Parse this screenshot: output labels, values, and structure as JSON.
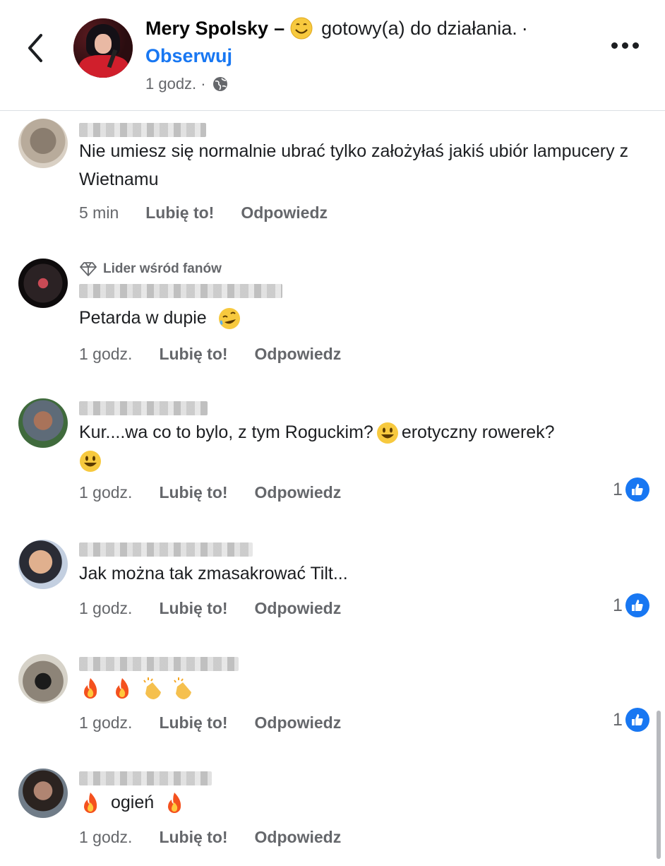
{
  "post": {
    "author": "Mery Spolsky",
    "dash": "–",
    "status": "gotowy(a) do działania.",
    "dot": "·",
    "follow_label": "Obserwuj",
    "time": "1 godz. ·",
    "more_label": "More options"
  },
  "comments": [
    {
      "text": "Nie umiesz się normalnie ubrać tylko założyłaś jakiś ubiór lampucery z Wietnamu",
      "time": "5 min",
      "like": "Lubię to!",
      "reply": "Odpowiedz"
    },
    {
      "badge": "Lider wśród fanów",
      "text": "Petarda w dupie",
      "time": "1 godz.",
      "like": "Lubię to!",
      "reply": "Odpowiedz"
    },
    {
      "text": "Kur....wa co to bylo, z tym Roguckim?",
      "text2": "erotyczny rowerek?",
      "time": "1 godz.",
      "like": "Lubię to!",
      "reply": "Odpowiedz",
      "reactions": "1"
    },
    {
      "text": "Jak można tak zmasakrować Tilt...",
      "time": "1 godz.",
      "like": "Lubię to!",
      "reply": "Odpowiedz",
      "reactions": "1"
    },
    {
      "text": "",
      "time": "1 godz.",
      "like": "Lubię to!",
      "reply": "Odpowiedz",
      "reactions": "1"
    },
    {
      "text": "ogień",
      "time": "1 godz.",
      "like": "Lubię to!",
      "reply": "Odpowiedz"
    }
  ],
  "colors": {
    "accent": "#1877f2",
    "secondary_text": "#65676b"
  },
  "icons": [
    "back-icon",
    "globe-icon",
    "more-icon",
    "diamond-icon",
    "like-thumb-icon",
    "fire-emoji",
    "clap-emoji",
    "smiley-emoji",
    "rofl-emoji"
  ]
}
